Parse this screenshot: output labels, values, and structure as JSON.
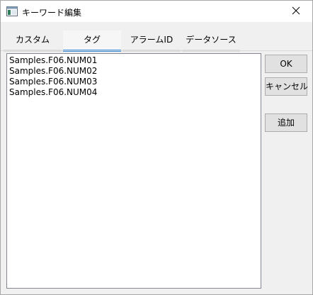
{
  "window": {
    "title": "キーワード編集",
    "icon": "app-window-icon",
    "close_icon": "close-icon"
  },
  "tabs": [
    {
      "label": "カスタム",
      "active": false
    },
    {
      "label": "タグ",
      "active": true
    },
    {
      "label": "アラームID",
      "active": false
    },
    {
      "label": "データソース",
      "active": false
    }
  ],
  "list": {
    "items": [
      "Samples.F06.NUM01",
      "Samples.F06.NUM02",
      "Samples.F06.NUM03",
      "Samples.F06.NUM04"
    ]
  },
  "buttons": {
    "ok": "OK",
    "cancel": "キャンセル",
    "add": "追加"
  },
  "colors": {
    "active_tab_underline": "#3a8edb",
    "window_bg": "#f0f0f0"
  }
}
